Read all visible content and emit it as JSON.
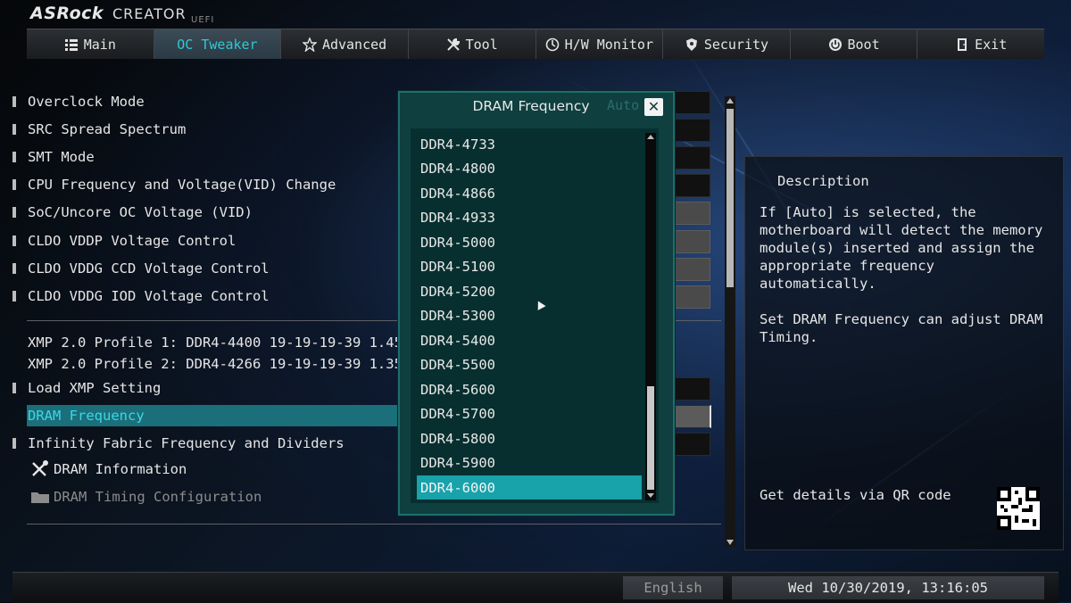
{
  "branding": {
    "brand": "ASRock",
    "product": "CREATOR",
    "uefi": "UEFI"
  },
  "tabs": [
    {
      "label": "Main",
      "icon": "list-icon"
    },
    {
      "label": "OC Tweaker",
      "icon": "",
      "active": true
    },
    {
      "label": "Advanced",
      "icon": "star-icon"
    },
    {
      "label": "Tool",
      "icon": "wrench-icon"
    },
    {
      "label": "H/W Monitor",
      "icon": "monitor-icon"
    },
    {
      "label": "Security",
      "icon": "shield-icon"
    },
    {
      "label": "Boot",
      "icon": "power-icon"
    },
    {
      "label": "Exit",
      "icon": "exit-icon"
    }
  ],
  "menu": {
    "overclock_mode": "Overclock Mode",
    "src_spread_spectrum": "SRC Spread Spectrum",
    "smt_mode": "SMT Mode",
    "cpu_freq_voltage": "CPU Frequency and Voltage(VID) Change",
    "soc_uncore": "SoC/Uncore OC Voltage (VID)",
    "cldo_vddp": "CLDO VDDP Voltage Control",
    "cldo_vddg_ccd": "CLDO VDDG CCD Voltage Control",
    "cldo_vddg_iod": "CLDO VDDG IOD Voltage Control",
    "xmp_profile_1": "XMP 2.0 Profile 1: DDR4-4400 19-19-19-39 1.45V",
    "xmp_profile_2": "XMP 2.0 Profile 2: DDR4-4266 19-19-19-39 1.35V",
    "load_xmp": "Load XMP Setting",
    "dram_frequency": "DRAM Frequency",
    "infinity_fabric": "Infinity Fabric Frequency and Dividers",
    "dram_information": "DRAM Information",
    "dram_timing": "DRAM Timing Configuration"
  },
  "description": {
    "title": "Description",
    "paragraph_1": "If [Auto] is selected, the motherboard will detect the memory module(s) inserted and assign the appropriate frequency automatically.",
    "paragraph_2": "Set DRAM Frequency can adjust DRAM Timing.",
    "qr_label": "Get details via QR code"
  },
  "dialog": {
    "title": "DRAM Frequency",
    "ghost_value": "Auto",
    "close_label": "✕",
    "options": [
      "DDR4-4733",
      "DDR4-4800",
      "DDR4-4866",
      "DDR4-4933",
      "DDR4-5000",
      "DDR4-5100",
      "DDR4-5200",
      "DDR4-5300",
      "DDR4-5400",
      "DDR4-5500",
      "DDR4-5600",
      "DDR4-5700",
      "DDR4-5800",
      "DDR4-5900",
      "DDR4-6000"
    ],
    "selected": "DDR4-6000"
  },
  "footer": {
    "language": "English",
    "datetime": "Wed 10/30/2019, 13:16:05"
  },
  "colors": {
    "accent": "#32c7d6",
    "selection": "#1a6f7a",
    "dialog_bg": "#0f3f3f",
    "option_highlight": "#18a2aa"
  }
}
